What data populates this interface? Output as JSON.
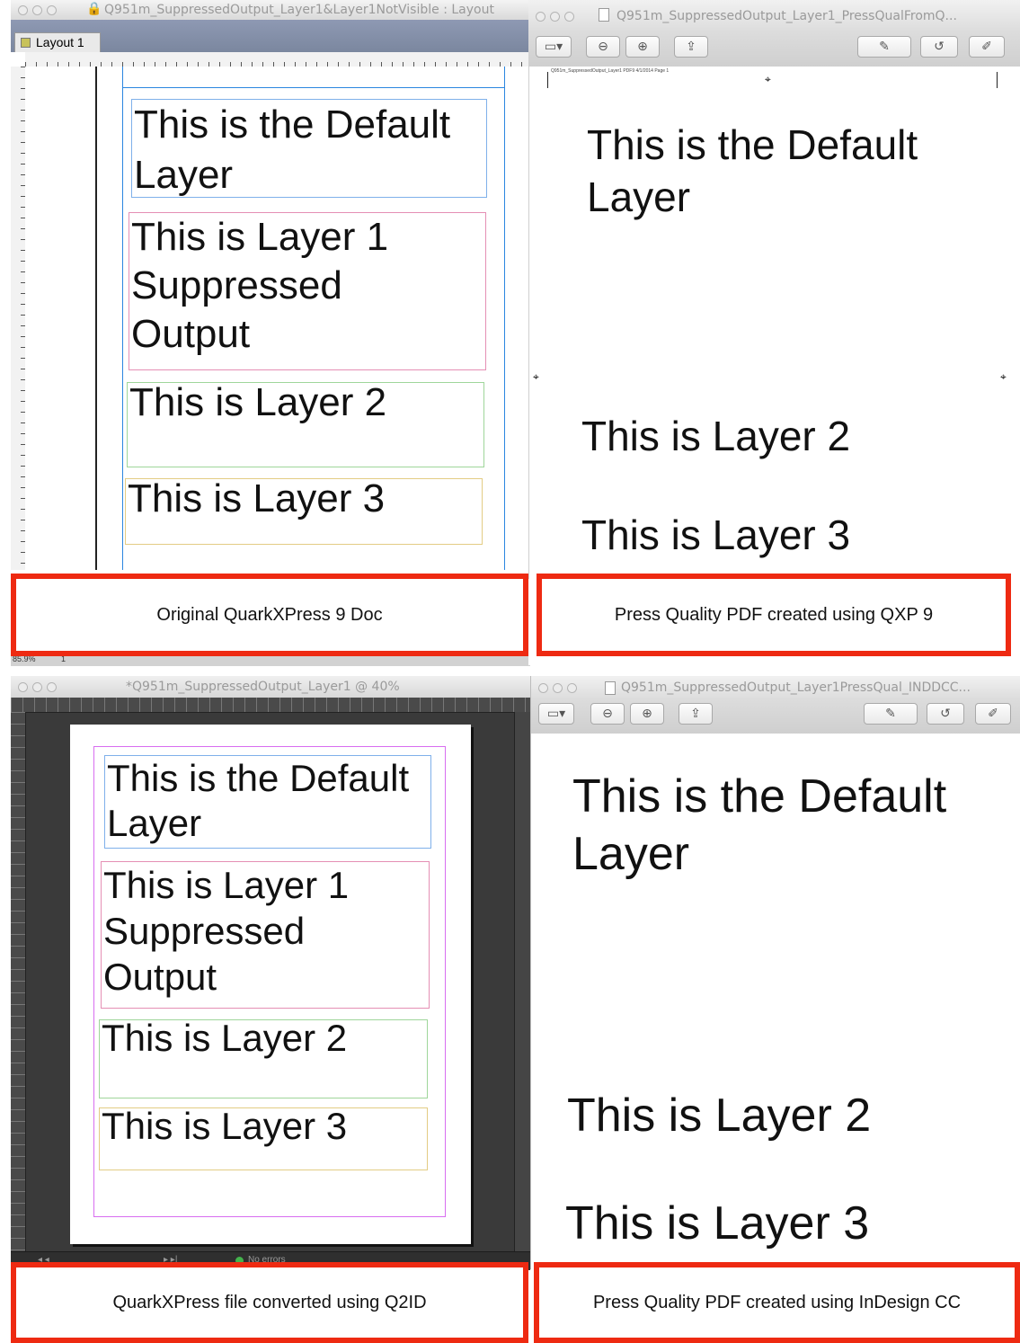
{
  "q1": {
    "window_title": "Q951m_SuppressedOutput_Layer1&Layer1NotVisible : Layout",
    "layout_tab": "Layout 1",
    "zoom": "85.9%",
    "zoom_page": "1",
    "frames": {
      "default": [
        "This is the Default",
        "Layer"
      ],
      "layer1": [
        "This is Layer 1",
        "Suppressed",
        "Output"
      ],
      "layer2": "This is Layer 2",
      "layer3": "This is Layer 3"
    },
    "caption": "Original QuarkXPress 9 Doc"
  },
  "q2": {
    "window_title": "Q951m_SuppressedOutput_Layer1_PressQualFromQ...",
    "toolbar": {
      "zoom_out": "⊖",
      "zoom_in": "⊕",
      "share": "⇪",
      "annotate": "✎",
      "rotate": "↺",
      "edit": "✐"
    },
    "page_header": "Q951m_SuppressedOutput_Layer1 PDF9 4/1/2014 Page 1",
    "texts": {
      "default": [
        "This is the Default",
        "Layer"
      ],
      "layer2": "This is Layer 2",
      "layer3": "This is Layer 3"
    },
    "caption": "Press Quality PDF created using QXP 9"
  },
  "q3": {
    "window_title": "*Q951m_SuppressedOutput_Layer1 @ 40%",
    "status": "No errors",
    "frames": {
      "default": [
        "This is the Default",
        "Layer"
      ],
      "layer1": [
        "This is Layer 1",
        "Suppressed",
        "Output"
      ],
      "layer2": "This is Layer 2",
      "layer3": "This is Layer 3"
    },
    "caption": "QuarkXPress file converted using Q2ID"
  },
  "q4": {
    "window_title": "Q951m_SuppressedOutput_Layer1PressQual_INDDCC...",
    "toolbar": {
      "zoom_out": "⊖",
      "zoom_in": "⊕",
      "share": "⇪",
      "annotate": "✎",
      "rotate": "↺",
      "edit": "✐"
    },
    "texts": {
      "default": [
        "This is the Default",
        "Layer"
      ],
      "layer2": "This is Layer 2",
      "layer3": "This is Layer 3"
    },
    "caption": "Press Quality PDF created using InDesign CC"
  },
  "colors": {
    "caption_border": "#ee2a12",
    "default_layer": "#7fb0ea",
    "layer1": "#e58fb4",
    "layer2": "#9fd69a",
    "layer3": "#e3cc84",
    "guide": "#2b86e0",
    "id_margin": "#d86ef0",
    "id_pasteboard": "#3a3a3a"
  }
}
